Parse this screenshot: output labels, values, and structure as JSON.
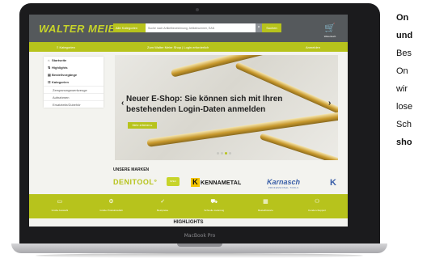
{
  "screen": {
    "logo": "WALTER MEIER",
    "search": {
      "category_label": "Alle Kategorien",
      "placeholder": "Suche nach Artikelbezeichnung, Artikelnummer, EAN",
      "clear_glyph": "×",
      "button_label": "Suchen"
    },
    "cart": {
      "glyph": "🛒",
      "label": "Warenkorb"
    },
    "nav": {
      "left": "≡ Kategorien",
      "center": "Zum Walter Meier Shop | Login erforderlich",
      "right": "Anmelden"
    },
    "sidebar": {
      "items": [
        {
          "icon": "⌂",
          "label": "Startseite"
        },
        {
          "icon": "⇅",
          "label": "Highlights"
        },
        {
          "icon": "▤",
          "label": "Bestellvorgänge"
        },
        {
          "icon": "☷",
          "label": "Kategorien"
        },
        {
          "icon": "",
          "label": "Zerspanungswerkzeuge"
        },
        {
          "icon": "",
          "label": "Aufnahmen"
        },
        {
          "icon": "",
          "label": "Ersatzteile/Zubehör"
        }
      ]
    },
    "hero": {
      "headline": "Neuer E-Shop: Sie können sich mit Ihren bestehenden Login-Daten anmelden",
      "button_label": "Mehr erfahren ▸",
      "prev_glyph": "‹",
      "next_glyph": "›",
      "slide_count": 4,
      "active_slide": 2
    },
    "brands": {
      "title": "UNSERE MARKEN",
      "denitool": "DENITOOL",
      "denitool_mark": "°",
      "box_label": "SPEC",
      "kennametal_k": "K",
      "kennametal": "KENNAMETAL",
      "karnasch": "Karnasch",
      "karnasch_sub": "PROFESSIONAL TOOLS",
      "k_partial": "K"
    },
    "features": [
      {
        "icon": "▭",
        "label": "Große Auswahl"
      },
      {
        "icon": "⚙",
        "label": "Große Produktvielfalt"
      },
      {
        "icon": "✓",
        "label": "Bestpreise"
      },
      {
        "icon": "⛟",
        "label": "Schnelle Lieferung"
      },
      {
        "icon": "▦",
        "label": "Bestellhistorie"
      },
      {
        "icon": "⚇",
        "label": "Kunden-Support"
      }
    ],
    "highlights_title": "HIGHLIGHTS"
  },
  "laptop": {
    "model_label": "MacBook Pro"
  },
  "side_text": {
    "lines": [
      "On",
      "und",
      "Bes",
      "On",
      "wir",
      "lose",
      "Sch",
      "sho"
    ],
    "bold_lines": [
      0,
      1,
      7
    ]
  },
  "colors": {
    "accent": "#b7c31c",
    "header": "#55595c",
    "logo": "#c7d42a",
    "bezel": "#1b1b1d"
  }
}
